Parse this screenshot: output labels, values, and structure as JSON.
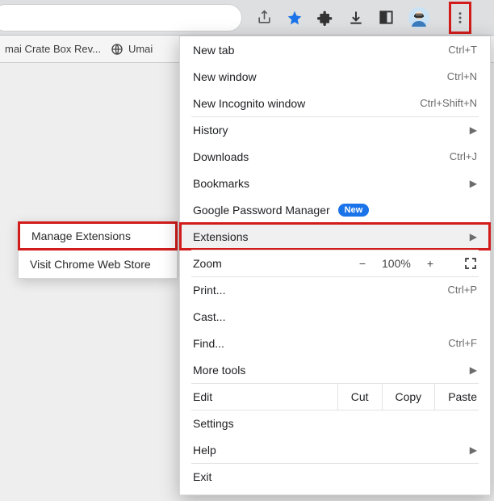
{
  "bookmarks_bar": {
    "item1": "mai Crate Box Rev...",
    "item2": "Umai"
  },
  "submenu": {
    "item1": "Manage Extensions",
    "item2": "Visit Chrome Web Store"
  },
  "menu": {
    "new_tab": {
      "label": "New tab",
      "shortcut": "Ctrl+T"
    },
    "new_window": {
      "label": "New window",
      "shortcut": "Ctrl+N"
    },
    "new_incognito": {
      "label": "New Incognito window",
      "shortcut": "Ctrl+Shift+N"
    },
    "history": {
      "label": "History"
    },
    "downloads": {
      "label": "Downloads",
      "shortcut": "Ctrl+J"
    },
    "bookmarks": {
      "label": "Bookmarks"
    },
    "password_manager": {
      "label": "Google Password Manager",
      "badge": "New"
    },
    "extensions": {
      "label": "Extensions"
    },
    "zoom": {
      "label": "Zoom",
      "minus": "−",
      "value": "100%",
      "plus": "+"
    },
    "print": {
      "label": "Print...",
      "shortcut": "Ctrl+P"
    },
    "cast": {
      "label": "Cast..."
    },
    "find": {
      "label": "Find...",
      "shortcut": "Ctrl+F"
    },
    "more_tools": {
      "label": "More tools"
    },
    "edit": {
      "label": "Edit",
      "cut": "Cut",
      "copy": "Copy",
      "paste": "Paste"
    },
    "settings": {
      "label": "Settings"
    },
    "help": {
      "label": "Help"
    },
    "exit": {
      "label": "Exit"
    }
  }
}
